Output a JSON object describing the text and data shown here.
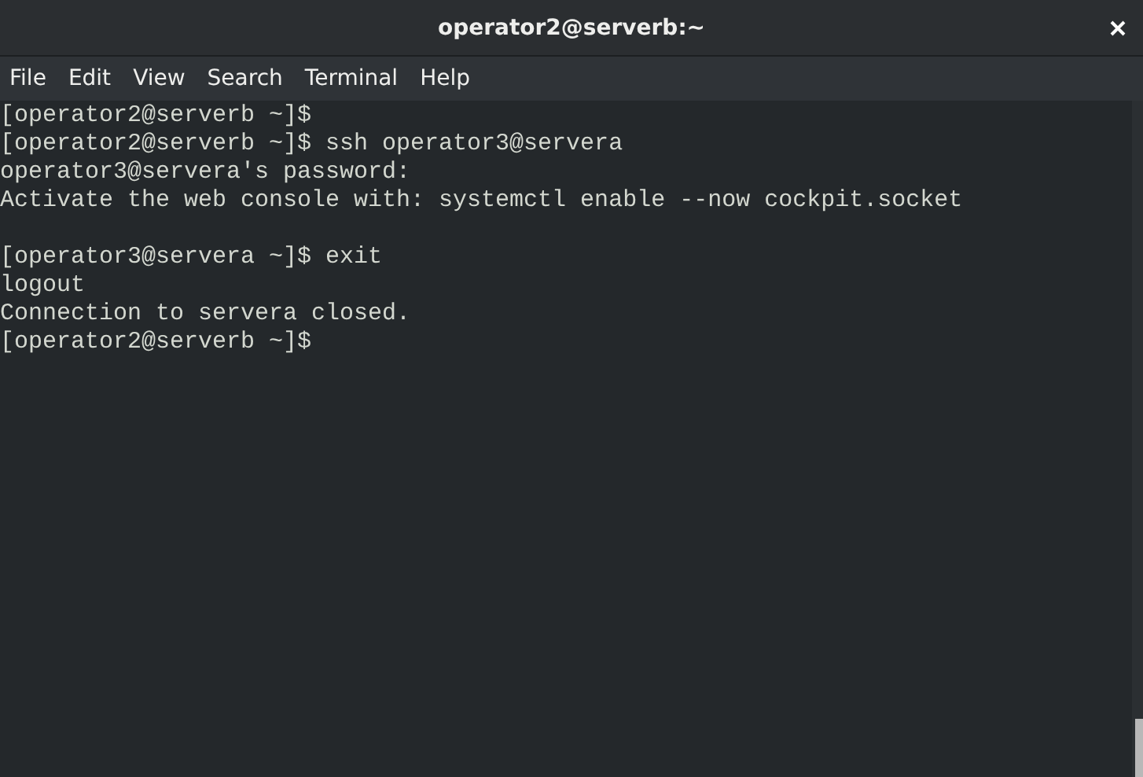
{
  "window": {
    "title": "operator2@serverb:~"
  },
  "menu": [
    "File",
    "Edit",
    "View",
    "Search",
    "Terminal",
    "Help"
  ],
  "terminal": {
    "lines": [
      {
        "kind": "text",
        "text": "[operator2@serverb ~]$"
      },
      {
        "kind": "text",
        "text": "[operator2@serverb ~]$ ssh operator3@servera"
      },
      {
        "kind": "text",
        "text": "operator3@servera's password:"
      },
      {
        "kind": "text",
        "text": "Activate the web console with: systemctl enable --now cockpit.socket"
      },
      {
        "kind": "blank"
      },
      {
        "kind": "text",
        "text": "[operator3@servera ~]$ exit"
      },
      {
        "kind": "text",
        "text": "logout"
      },
      {
        "kind": "text",
        "text": "Connection to servera closed."
      },
      {
        "kind": "text",
        "text": "[operator2@serverb ~]$"
      }
    ]
  }
}
